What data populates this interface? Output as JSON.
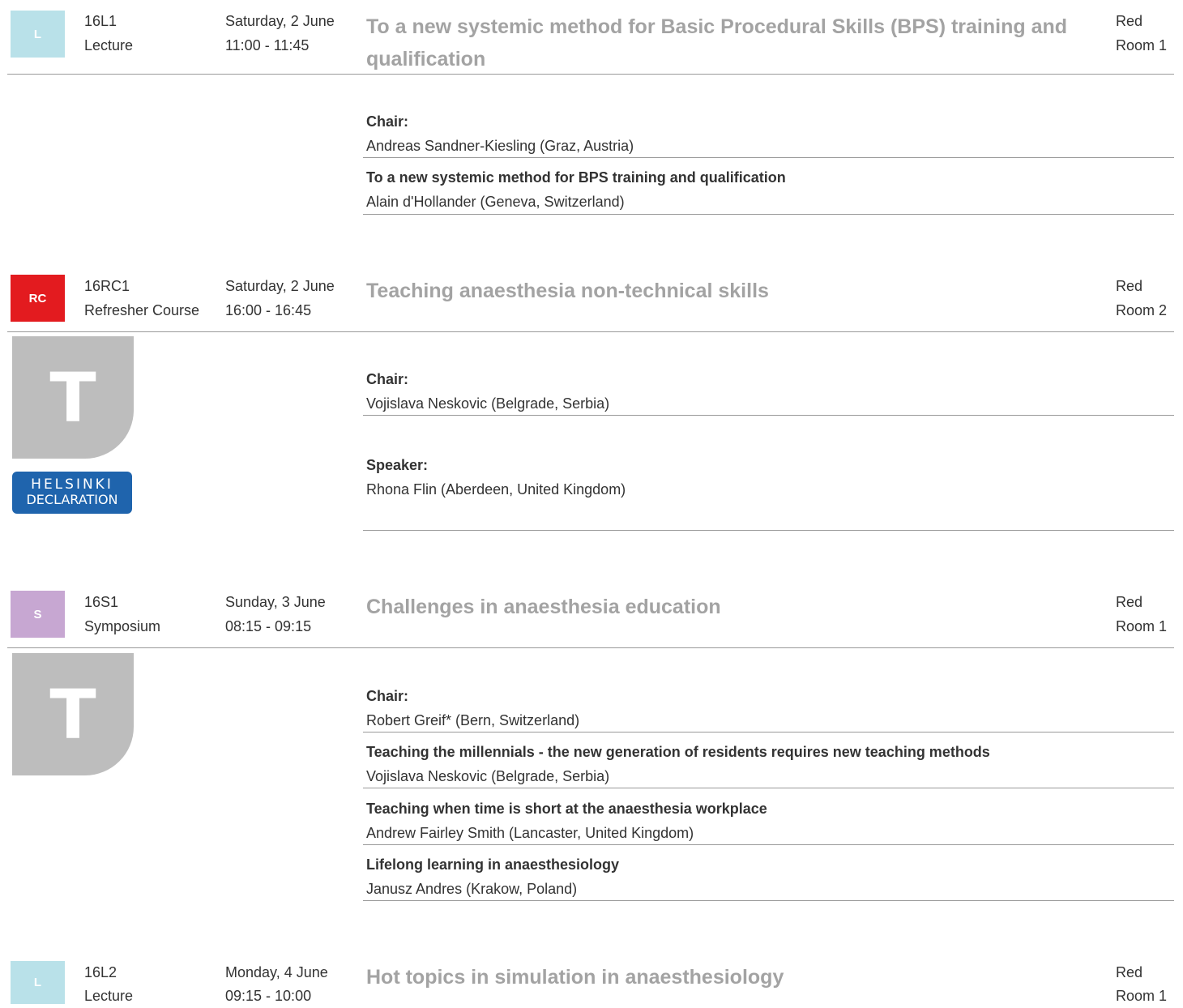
{
  "sessions": [
    {
      "badge": "L",
      "badge_color": "#b9e1e9",
      "code": "16L1",
      "type": "Lecture",
      "date": "Saturday, 2 June",
      "time": "11:00 - 11:45",
      "title": "To a new systemic method for Basic Procedural Skills (BPS) training and qualification",
      "track": "Red",
      "room": "Room 1",
      "chair_label": "Chair:",
      "chair": "Andreas Sandner-Kiesling (Graz, Austria)",
      "talks": [
        {
          "title": "To a new systemic method for BPS training and qualification",
          "speaker": "Alain d'Hollander (Geneva, Switzerland)"
        }
      ]
    },
    {
      "badge": "RC",
      "badge_color": "#e31b1f",
      "code": "16RC1",
      "type": "Refresher Course",
      "date": "Saturday, 2 June",
      "time": "16:00 - 16:45",
      "title": "Teaching anaesthesia non-technical skills",
      "track": "Red",
      "room": "Room 2",
      "tile_letter": "T",
      "logo_line1": "HELSINKI",
      "logo_line2": "DECLARATION",
      "chair_label": "Chair:",
      "chair": "Vojislava Neskovic (Belgrade, Serbia)",
      "speaker_label": "Speaker:",
      "speaker": "Rhona Flin (Aberdeen, United Kingdom)"
    },
    {
      "badge": "S",
      "badge_color": "#c7a7d2",
      "code": "16S1",
      "type": "Symposium",
      "date": "Sunday, 3 June",
      "time": "08:15 - 09:15",
      "title": "Challenges in anaesthesia education",
      "track": "Red",
      "room": "Room 1",
      "tile_letter": "T",
      "chair_label": "Chair:",
      "chair": "Robert Greif* (Bern, Switzerland)",
      "talks": [
        {
          "title": "Teaching the millennials - the new generation of residents requires new teaching methods",
          "speaker": "Vojislava Neskovic (Belgrade, Serbia)"
        },
        {
          "title": "Teaching when time is short at the anaesthesia workplace",
          "speaker": "Andrew Fairley Smith (Lancaster, United Kingdom)"
        },
        {
          "title": "Lifelong learning in anaesthesiology",
          "speaker": "Janusz Andres (Krakow, Poland)"
        }
      ]
    },
    {
      "badge": "L",
      "badge_color": "#b9e1e9",
      "code": "16L2",
      "type": "Lecture",
      "date": "Monday, 4 June",
      "time": "09:15 - 10:00",
      "title": "Hot topics in simulation in anaesthesiology",
      "track": "Red",
      "room": "Room 1"
    }
  ]
}
